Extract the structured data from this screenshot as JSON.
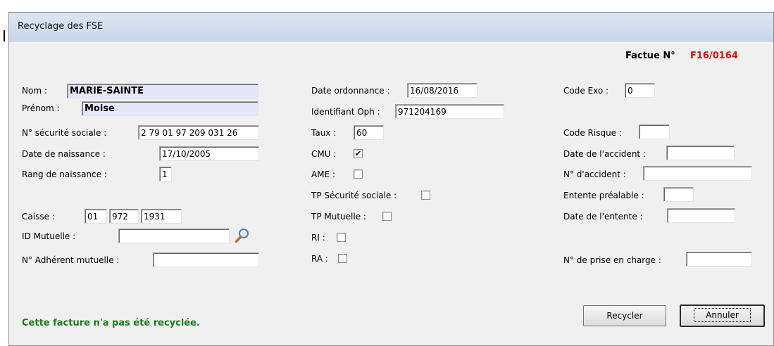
{
  "window": {
    "title": "Recyclage des FSE"
  },
  "facture": {
    "label": "Factue N°",
    "number": "F16/0164"
  },
  "left": {
    "nom_label": "Nom :",
    "nom_value": "MARIE-SAINTE",
    "prenom_label": "Prénom :",
    "prenom_value": "Moise",
    "secu_label": "N° sécurité sociale :",
    "secu_value": "2 79 01 97 209 031 26",
    "naissance_label": "Date de naissance :",
    "naissance_value": "17/10/2005",
    "rang_label": "Rang de naissance :",
    "rang_value": "1",
    "caisse_label": "Caisse :",
    "caisse_1": "01",
    "caisse_2": "972",
    "caisse_3": "1931",
    "mutuelle_label": "ID Mutuelle :",
    "mutuelle_value": "",
    "adherent_label": "N° Adhérent mutuelle :",
    "adherent_value": ""
  },
  "middle": {
    "date_ord_label": "Date ordonnance :",
    "date_ord_value": "16/08/2016",
    "oph_label": "Identifiant Oph :",
    "oph_value": "971204169",
    "taux_label": "Taux :",
    "taux_value": "60",
    "cmu_label": "CMU :",
    "cmu_checked": "✔",
    "ame_label": "AME :",
    "tp_secu_label": "TP Sécurité sociale :",
    "tp_mut_label": "TP Mutuelle :",
    "ri_label": "RI :",
    "ra_label": "RA :"
  },
  "right": {
    "code_exo_label": "Code Exo :",
    "code_exo_value": "0",
    "code_risque_label": "Code Risque :",
    "code_risque_value": "",
    "date_accident_label": "Date de l'accident :",
    "date_accident_value": "",
    "num_accident_label": "N° d'accident :",
    "num_accident_value": "",
    "entente_label": "Entente préalable :",
    "entente_value": "",
    "date_entente_label": "Date de l'entente :",
    "date_entente_value": "",
    "prise_label": "N° de prise en charge :",
    "prise_value": ""
  },
  "status": {
    "message": "Cette facture n'a pas été recyclée."
  },
  "buttons": {
    "recycler": "Recycler",
    "annuler": "Annuler"
  },
  "colors": {
    "status_green": "#1a7d1a",
    "facture_red": "#e01010",
    "highlight": "#e6e6fa"
  },
  "icons": {
    "search": "magnifier-icon"
  }
}
